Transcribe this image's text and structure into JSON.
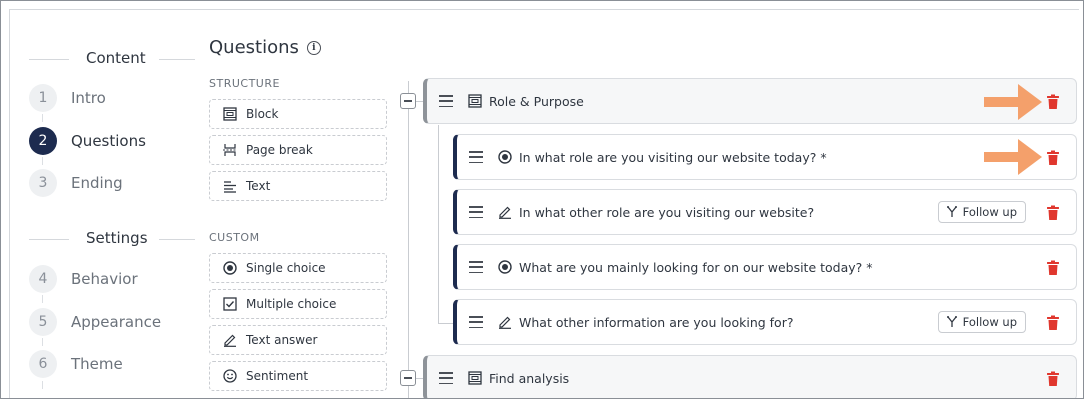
{
  "nav": {
    "content_heading": "Content",
    "settings_heading": "Settings",
    "content_steps": [
      {
        "num": "1",
        "label": "Intro"
      },
      {
        "num": "2",
        "label": "Questions"
      },
      {
        "num": "3",
        "label": "Ending"
      }
    ],
    "settings_steps": [
      {
        "num": "4",
        "label": "Behavior"
      },
      {
        "num": "5",
        "label": "Appearance"
      },
      {
        "num": "6",
        "label": "Theme"
      }
    ],
    "active_step": "2"
  },
  "palette": {
    "title": "Questions",
    "structure_label": "STRUCTURE",
    "structure_items": [
      "Block",
      "Page break",
      "Text"
    ],
    "custom_label": "CUSTOM",
    "custom_items": [
      "Single choice",
      "Multiple choice",
      "Text answer",
      "Sentiment"
    ]
  },
  "tree": {
    "block1": {
      "title": "Role & Purpose"
    },
    "questions": [
      {
        "title": "In what role are you visiting our website today? *",
        "type_icon": "radio-icon",
        "follow_up": ""
      },
      {
        "title": "In what other role are you visiting our website?",
        "type_icon": "pencil-icon",
        "follow_up": "Follow up"
      },
      {
        "title": "What are you mainly looking for on our website today? *",
        "type_icon": "radio-icon",
        "follow_up": ""
      },
      {
        "title": "What other information are you looking for?",
        "type_icon": "pencil-icon",
        "follow_up": "Follow up"
      }
    ],
    "block2": {
      "title": "Find analysis"
    }
  },
  "colors": {
    "accent": "#1d2b4f",
    "delete": "#e0372e",
    "arrow": "#f4a06b"
  }
}
